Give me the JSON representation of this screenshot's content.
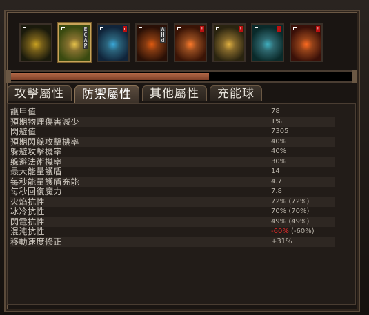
{
  "skills": [
    {
      "name": "sword-skill-icon",
      "colors": [
        "#1a1a0c",
        "#c8a020"
      ],
      "active": false
    },
    {
      "name": "arrow-skill-icon",
      "colors": [
        "#3a4a10",
        "#e6c24a"
      ],
      "active": true,
      "vtag": "ECAP"
    },
    {
      "name": "ice-skill-icon",
      "colors": [
        "#10243a",
        "#3aa8d8"
      ],
      "tag": "r"
    },
    {
      "name": "fire-skill-icon",
      "colors": [
        "#2a1006",
        "#e05a10"
      ],
      "vtag": "AHd"
    },
    {
      "name": "flame-skill-icon",
      "colors": [
        "#3a1406",
        "#ff7a2a"
      ],
      "tag": "!"
    },
    {
      "name": "totem-skill-icon",
      "colors": [
        "#2a2410",
        "#e0b040"
      ],
      "tag": "!"
    },
    {
      "name": "frost-skill-icon",
      "colors": [
        "#0a2a2a",
        "#40b0c0"
      ],
      "tag": "r"
    },
    {
      "name": "blaze-skill-icon",
      "colors": [
        "#3a1008",
        "#ff6a20"
      ],
      "tag": "!"
    }
  ],
  "progress": {
    "fraction": 0.58
  },
  "tabs": [
    {
      "label": "攻擊屬性",
      "active": false
    },
    {
      "label": "防禦屬性",
      "active": true
    },
    {
      "label": "其他屬性",
      "active": false
    },
    {
      "label": "充能球",
      "active": false
    }
  ],
  "stats": [
    {
      "name": "護甲值",
      "value": "78"
    },
    {
      "name": "預期物理傷害減少",
      "value": "1%"
    },
    {
      "name": "閃避值",
      "value": "7305"
    },
    {
      "name": "預期閃躲攻擊機率",
      "value": "40%"
    },
    {
      "name": "躲避攻擊機率",
      "value": "40%"
    },
    {
      "name": "躲避法術機率",
      "value": "30%"
    },
    {
      "name": "最大能量護盾",
      "value": "14"
    },
    {
      "name": "每秒能量護盾充能",
      "value": "4.7"
    },
    {
      "name": "每秒回復魔力",
      "value": "7.8"
    },
    {
      "name": "火焰抗性",
      "value": "72% (72%)"
    },
    {
      "name": "冰冷抗性",
      "value": "70% (70%)"
    },
    {
      "name": "閃電抗性",
      "value": "49% (49%)"
    },
    {
      "name": "混沌抗性",
      "value_neg": "-60%",
      "value_rest": " (-60%)"
    },
    {
      "name": "移動速度修正",
      "value": "+31%"
    }
  ]
}
